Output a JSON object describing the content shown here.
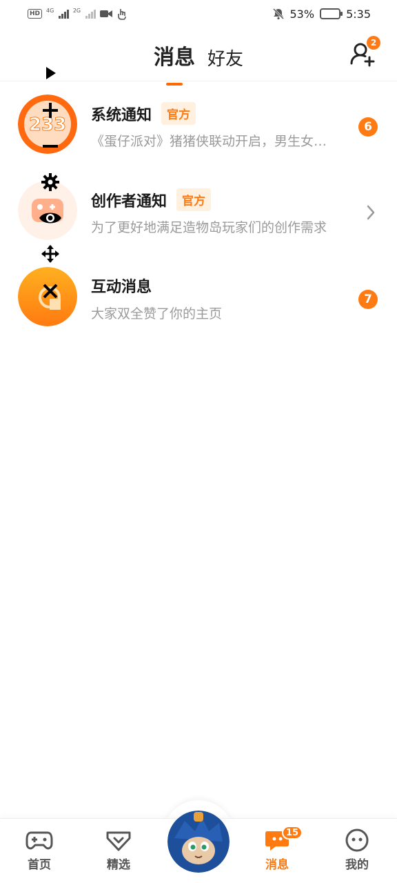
{
  "status_bar": {
    "hd": "HD",
    "net1": "4G",
    "net2": "2G",
    "battery_percent": "53%",
    "time": "5:35"
  },
  "header": {
    "tabs": [
      {
        "label": "消息",
        "active": true
      },
      {
        "label": "好友",
        "active": false
      }
    ],
    "add_friend_badge": "2"
  },
  "messages": [
    {
      "title": "系统通知",
      "tag": "官方",
      "subtitle": "《蛋仔派对》猪猪侠联动开启，男生女生向前冲！",
      "count": "6",
      "avatar_number": "233",
      "icon": "notification-avatar"
    },
    {
      "title": "创作者通知",
      "tag": "官方",
      "subtitle": "为了更好地满足造物岛玩家们的创作需求",
      "count": "",
      "icon": "creator-avatar"
    },
    {
      "title": "互动消息",
      "tag": "",
      "subtitle": "大家双全赞了你的主页",
      "count": "7",
      "icon": "interaction-avatar"
    }
  ],
  "tools": [
    "play-icon",
    "zoom-in-icon",
    "zoom-out-icon",
    "gear-icon",
    "eye-icon",
    "move-icon",
    "close-icon"
  ],
  "bottom_nav": {
    "items": [
      {
        "label": "首页",
        "icon": "gamepad-icon"
      },
      {
        "label": "精选",
        "icon": "heart-badge-icon"
      },
      {
        "label": "消息",
        "icon": "message-icon",
        "badge": "15",
        "active": true
      },
      {
        "label": "我的",
        "icon": "face-icon"
      }
    ]
  },
  "colors": {
    "accent": "#ff7a10",
    "tag_bg": "#fff0e0",
    "subtitle": "#9a9a9a"
  }
}
